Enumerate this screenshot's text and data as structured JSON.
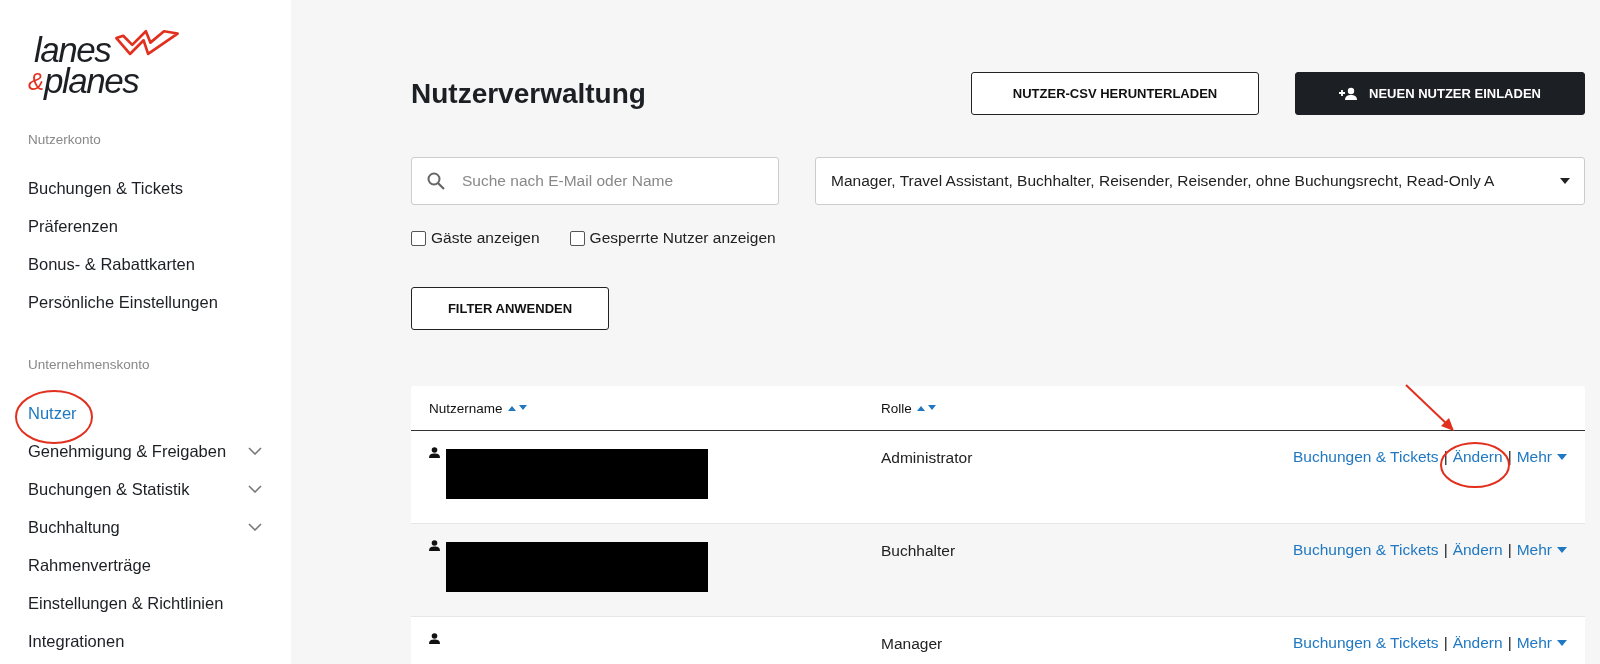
{
  "logo": {
    "line_1": "lanes",
    "ampersand": "&",
    "line_2": "planes"
  },
  "sidebar": {
    "sections": [
      {
        "heading": "Nutzerkonto",
        "items": [
          {
            "label": "Buchungen & Tickets",
            "selected": false,
            "expandable": false
          },
          {
            "label": "Präferenzen",
            "selected": false,
            "expandable": false
          },
          {
            "label": "Bonus- & Rabattkarten",
            "selected": false,
            "expandable": false
          },
          {
            "label": "Persönliche Einstellungen",
            "selected": false,
            "expandable": false
          }
        ]
      },
      {
        "heading": "Unternehmenskonto",
        "items": [
          {
            "label": "Nutzer",
            "selected": true,
            "expandable": false
          },
          {
            "label": "Genehmigung & Freigaben",
            "selected": false,
            "expandable": true
          },
          {
            "label": "Buchungen & Statistik",
            "selected": false,
            "expandable": true
          },
          {
            "label": "Buchhaltung",
            "selected": false,
            "expandable": true
          },
          {
            "label": "Rahmenverträge",
            "selected": false,
            "expandable": false
          },
          {
            "label": "Einstellungen & Richtlinien",
            "selected": false,
            "expandable": false
          },
          {
            "label": "Integrationen",
            "selected": false,
            "expandable": false
          }
        ]
      }
    ]
  },
  "page": {
    "title": "Nutzerverwaltung",
    "buttons": [
      {
        "label": "NUTZER-CSV HERUNTERLADEN",
        "kind": "outline"
      },
      {
        "label": "NEUEN NUTZER EINLADEN",
        "kind": "primary"
      }
    ],
    "search": {
      "placeholder": "Suche nach E-Mail oder Name"
    },
    "role_filter": {
      "value": "Manager, Travel Assistant, Buchhalter, Reisender, Reisender, ohne Buchungsrecht, Read-Only A"
    },
    "checkboxes": [
      {
        "label": "Gäste anzeigen",
        "checked": false
      },
      {
        "label": "Gesperrte Nutzer anzeigen",
        "checked": false
      }
    ],
    "apply_button": "FILTER ANWENDEN"
  },
  "table": {
    "columns": [
      "Nutzername",
      "Rolle"
    ],
    "rows": [
      {
        "redacted": true,
        "role": "Administrator",
        "actions": [
          "Buchungen & Tickets",
          "Ändern",
          "Mehr"
        ],
        "separators": [
          "|",
          "|"
        ]
      },
      {
        "redacted": true,
        "role": "Buchhalter",
        "actions": [
          "Buchungen & Tickets",
          "Ändern",
          "Mehr"
        ],
        "separators": [
          "|",
          "|"
        ]
      },
      {
        "redacted": false,
        "role": "Manager",
        "actions": [
          "Buchungen & Tickets",
          "Ändern",
          "Mehr"
        ],
        "separators": [
          "|",
          "|"
        ]
      }
    ]
  }
}
